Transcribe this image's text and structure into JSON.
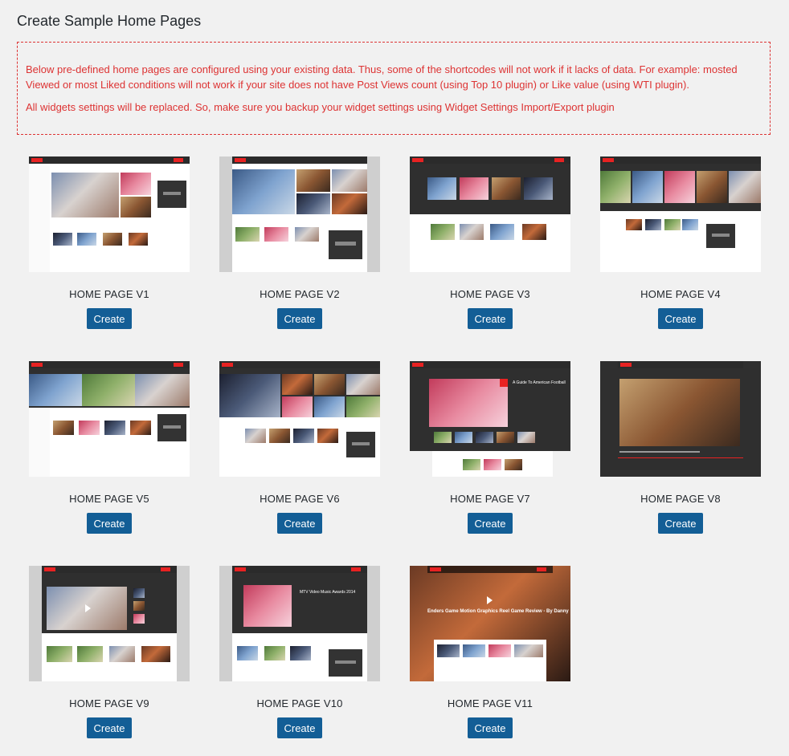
{
  "page_title": "Create Sample Home Pages",
  "notice": {
    "line1": "Below pre-defined home pages are configured using your existing data. Thus, some of the shortcodes will not work if it lacks of data. For example: mosted Viewed or most Liked conditions will not work if your site does not have Post Views count (using Top 10 plugin) or Like value (using WTI plugin).",
    "line2": "All widgets settings will be replaced. So, make sure you backup your widget settings using Widget Settings Import/Export plugin"
  },
  "cards": [
    {
      "title": "HOME PAGE V1",
      "button": "Create"
    },
    {
      "title": "HOME PAGE V2",
      "button": "Create"
    },
    {
      "title": "HOME PAGE V3",
      "button": "Create"
    },
    {
      "title": "HOME PAGE V4",
      "button": "Create"
    },
    {
      "title": "HOME PAGE V5",
      "button": "Create"
    },
    {
      "title": "HOME PAGE V6",
      "button": "Create"
    },
    {
      "title": "HOME PAGE V7",
      "button": "Create"
    },
    {
      "title": "HOME PAGE V8",
      "button": "Create"
    },
    {
      "title": "HOME PAGE V9",
      "button": "Create"
    },
    {
      "title": "HOME PAGE V10",
      "button": "Create"
    },
    {
      "title": "HOME PAGE V11",
      "button": "Create"
    }
  ],
  "thumb_text": {
    "v7_headline": "A Guide To American Football",
    "v10_headline": "MTV Video Music Awards 2014",
    "v11_headline": "Enders Game Motion Graphics Reel Game Review - By Danny"
  },
  "colors": {
    "accent_button": "#135e96",
    "notice_red": "#dd3333",
    "background": "#f1f1f1"
  }
}
